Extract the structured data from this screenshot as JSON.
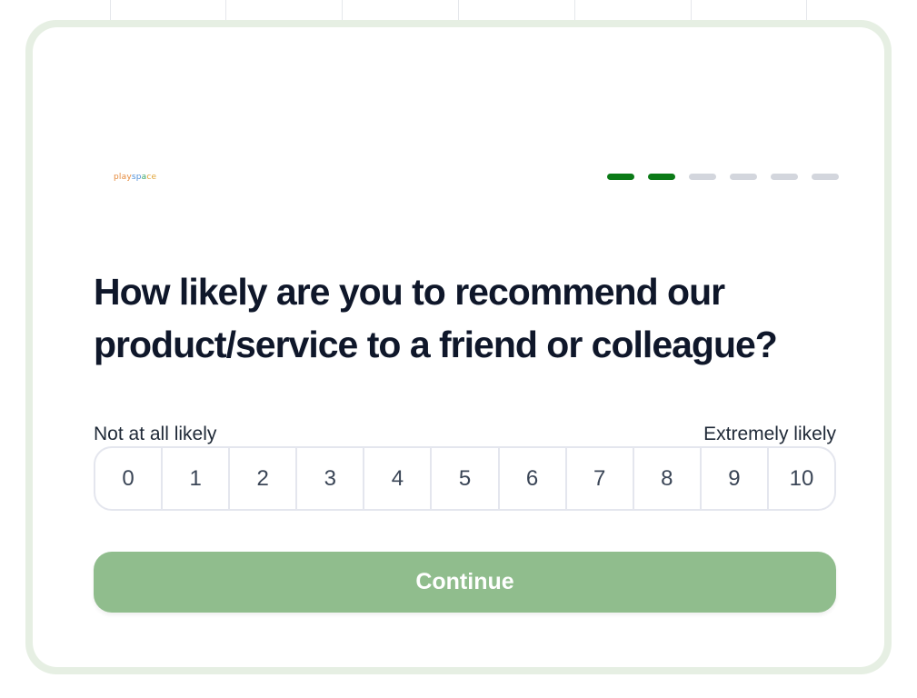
{
  "logo": {
    "text_part1": "play",
    "text_part2": "sp",
    "text_part3": "a",
    "text_part4": "ce"
  },
  "progress": {
    "total_steps": 6,
    "completed_steps": 2,
    "active_color": "#0b7a17",
    "inactive_color": "#d3d6dd"
  },
  "question": {
    "text": "How likely are you to recommend our product/service to a friend or colleague?"
  },
  "scale": {
    "min_label": "Not at all likely",
    "max_label": "Extremely likely",
    "options": [
      "0",
      "1",
      "2",
      "3",
      "4",
      "5",
      "6",
      "7",
      "8",
      "9",
      "10"
    ]
  },
  "continue_button": {
    "label": "Continue",
    "color": "#90bd8d"
  },
  "colors": {
    "card_border": "#e6efe3",
    "heading": "#0f172a"
  }
}
